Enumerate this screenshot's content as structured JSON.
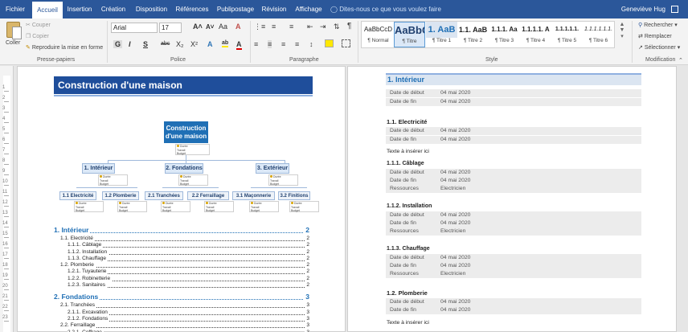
{
  "tabs": [
    {
      "label": "Fichier",
      "active": false
    },
    {
      "label": "Accueil",
      "active": true
    },
    {
      "label": "Insertion",
      "active": false
    },
    {
      "label": "Création",
      "active": false
    },
    {
      "label": "Disposition",
      "active": false
    },
    {
      "label": "Références",
      "active": false
    },
    {
      "label": "Publipostage",
      "active": false
    },
    {
      "label": "Révision",
      "active": false
    },
    {
      "label": "Affichage",
      "active": false
    }
  ],
  "tell_me": "Dites-nous ce que vous voulez faire",
  "user_name": "Geneviève Hug",
  "clipboard": {
    "paste": "Coller",
    "cut": "Couper",
    "copy": "Copier",
    "format_painter": "Reproduire la mise en forme",
    "group": "Presse-papiers"
  },
  "font": {
    "name": "Arial",
    "size": "17",
    "grow": "A˄",
    "shrink": "A˅",
    "case": "Aa",
    "clear": "A",
    "bold": "G",
    "italic": "I",
    "underline": "S",
    "strike": "abc",
    "subscript": "X₂",
    "superscript": "X²",
    "effects": "A",
    "highlight": "ab",
    "color": "A",
    "group": "Police"
  },
  "paragraph": {
    "group": "Paragraphe",
    "pilcrow": "¶"
  },
  "styles": {
    "group": "Style",
    "items": [
      {
        "sample": "AaBbCcD",
        "name": "¶ Normal"
      },
      {
        "sample": "AaBbC",
        "name": "¶ Titre"
      },
      {
        "sample": "1. AaB",
        "name": "¶ Titre 1"
      },
      {
        "sample": "1.1. AaB",
        "name": "¶ Titre 2"
      },
      {
        "sample": "1.1.1. Aa",
        "name": "¶ Titre 3"
      },
      {
        "sample": "1.1.1.1. A",
        "name": "¶ Titre 4"
      },
      {
        "sample": "1.1.1.1.1.",
        "name": "¶ Titre 5"
      },
      {
        "sample": "1.1.1.1.1.1.",
        "name": "¶ Titre 6"
      }
    ],
    "selected_index": 1
  },
  "editing": {
    "find": "Rechercher",
    "replace": "Remplacer",
    "select": "Sélectionner",
    "group": "Modification"
  },
  "ruler_numbers": [
    "1",
    "2",
    "3",
    "4",
    "5",
    "6",
    "7",
    "8",
    "9",
    "10",
    "11",
    "12",
    "13",
    "14",
    "15",
    "16",
    "17",
    "18",
    "19",
    "20",
    "21",
    "22",
    "23",
    "24"
  ],
  "page1": {
    "title": "Construction d'une maison",
    "diagram": {
      "root": "Construction d'une maison",
      "level1": [
        "1. Intérieur",
        "2. Fondations",
        "3. Extérieur"
      ],
      "level2": [
        "1.1 Electricité",
        "1.2 Plomberie",
        "2.1 Tranchées",
        "2.2 Ferraillage",
        "3.1 Maçonnerie",
        "3.2 Finitions"
      ],
      "mini_lines": [
        "Durée",
        "Travail",
        "Budget"
      ]
    },
    "toc": [
      {
        "level": 1,
        "text": "1. Intérieur",
        "page": "2"
      },
      {
        "level": 2,
        "text": "1.1. Electricité",
        "page": "2"
      },
      {
        "level": 3,
        "text": "1.1.1. Câblage",
        "page": "2"
      },
      {
        "level": 3,
        "text": "1.1.2. Installation",
        "page": "2"
      },
      {
        "level": 3,
        "text": "1.1.3. Chauffage",
        "page": "2"
      },
      {
        "level": 2,
        "text": "1.2. Plomberie",
        "page": "2"
      },
      {
        "level": 3,
        "text": "1.2.1. Tuyauterie",
        "page": "2"
      },
      {
        "level": 3,
        "text": "1.2.2. Robinetterie",
        "page": "2"
      },
      {
        "level": 3,
        "text": "1.2.3. Sanitaires",
        "page": "2"
      },
      {
        "level": 1,
        "text": "2. Fondations",
        "page": "3"
      },
      {
        "level": 2,
        "text": "2.1. Tranchées",
        "page": "3"
      },
      {
        "level": 3,
        "text": "2.1.1. Excavation",
        "page": "3"
      },
      {
        "level": 3,
        "text": "2.1.2. Fondations",
        "page": "3"
      },
      {
        "level": 2,
        "text": "2.2. Ferraillage",
        "page": "3"
      },
      {
        "level": 3,
        "text": "2.2.1. Coffrage",
        "page": "3"
      }
    ]
  },
  "page2": {
    "h1": "1. Intérieur",
    "labels": {
      "start": "Date de début",
      "end": "Date de fin",
      "resources": "Ressources"
    },
    "date": "04 mai 2020",
    "electrician": "Electricien",
    "insert_text": "Texte à insérer ici",
    "sections": {
      "s11": "1.1. Electricité",
      "s111": "1.1.1. Câblage",
      "s112": "1.1.2. Installation",
      "s113": "1.1.3. Chauffage",
      "s12": "1.2. Plomberie"
    }
  }
}
